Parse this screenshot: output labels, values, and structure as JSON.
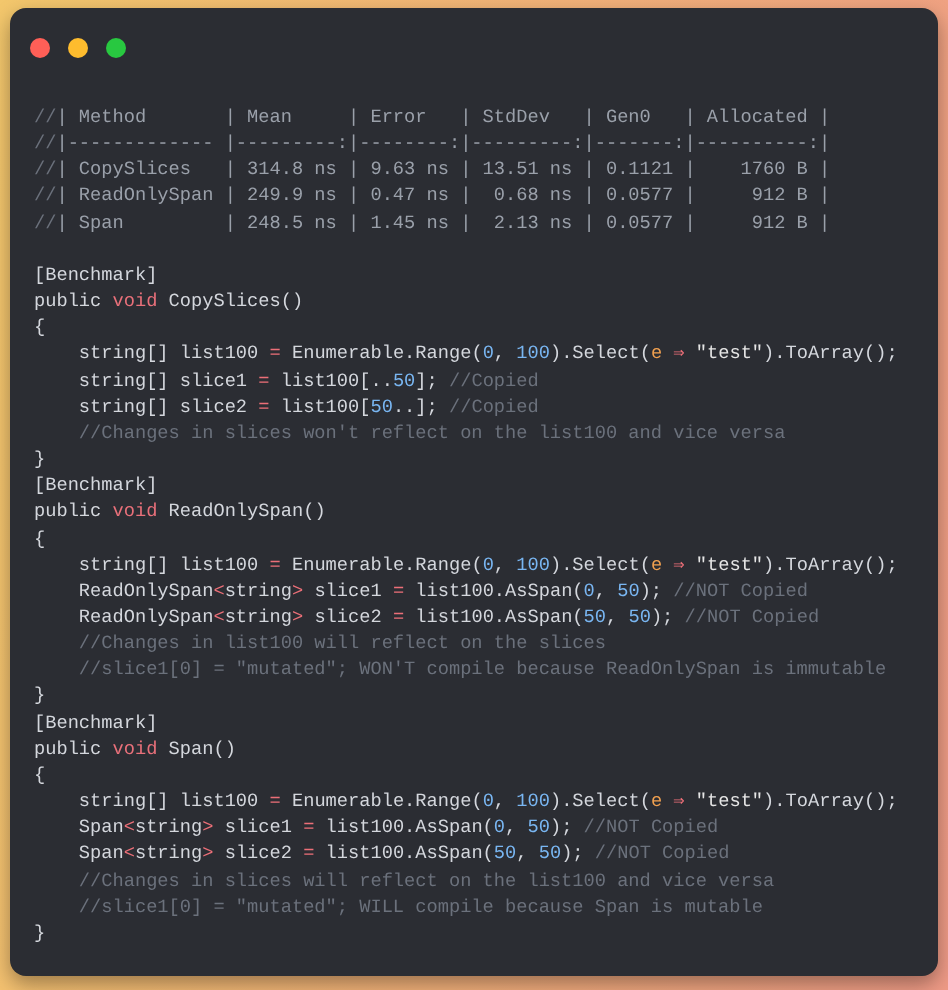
{
  "window": {
    "controls": [
      {
        "kind": "close"
      },
      {
        "kind": "minimize"
      },
      {
        "kind": "maximize"
      }
    ]
  },
  "lines": [
    {
      "kind": "code",
      "tokens": [
        {
          "text": "//",
          "kind": "comment"
        },
        {
          "text": "| Method       | Mean     | Error   | StdDev   | Gen0   | Allocated |",
          "kind": "table"
        }
      ]
    },
    {
      "kind": "code",
      "tokens": [
        {
          "text": "//",
          "kind": "comment"
        },
        {
          "text": "|------------- |---------:|--------:|---------:|-------:|----------:|",
          "kind": "table"
        }
      ]
    },
    {
      "kind": "code",
      "tokens": [
        {
          "text": "//",
          "kind": "comment"
        },
        {
          "text": "| CopySlices   | 314.8 ns | 9.63 ns | 13.51 ns | 0.1121 |    1760 B |",
          "kind": "table"
        }
      ]
    },
    {
      "kind": "code",
      "tokens": [
        {
          "text": "//",
          "kind": "comment"
        },
        {
          "text": "| ReadOnlySpan | 249.9 ns | 0.47 ns |  0.68 ns | 0.0577 |     912 B |",
          "kind": "table"
        }
      ]
    },
    {
      "kind": "code",
      "tokens": [
        {
          "text": "//",
          "kind": "comment"
        },
        {
          "text": "| Span         | 248.5 ns | 1.45 ns |  2.13 ns | 0.0577 |     912 B |",
          "kind": "table"
        }
      ]
    },
    {
      "kind": "blank"
    },
    {
      "kind": "code",
      "tokens": [
        {
          "text": "[Benchmark]",
          "kind": "plain"
        }
      ]
    },
    {
      "kind": "code",
      "tokens": [
        {
          "text": "public ",
          "kind": "plain"
        },
        {
          "text": "void",
          "kind": "keyword"
        },
        {
          "text": " CopySlices()",
          "kind": "plain"
        }
      ]
    },
    {
      "kind": "code",
      "tokens": [
        {
          "text": "{",
          "kind": "plain"
        }
      ]
    },
    {
      "kind": "code",
      "tokens": [
        {
          "text": "    string[] list100 ",
          "kind": "plain"
        },
        {
          "text": "=",
          "kind": "operator"
        },
        {
          "text": " Enumerable.Range(",
          "kind": "plain"
        },
        {
          "text": "0",
          "kind": "number"
        },
        {
          "text": ", ",
          "kind": "plain"
        },
        {
          "text": "100",
          "kind": "number"
        },
        {
          "text": ").Select(",
          "kind": "plain"
        },
        {
          "text": "e",
          "kind": "param"
        },
        {
          "text": " ⇒ ",
          "kind": "operator"
        },
        {
          "text": "\"test\"",
          "kind": "string"
        },
        {
          "text": ").ToArray();",
          "kind": "plain"
        }
      ]
    },
    {
      "kind": "code",
      "tokens": [
        {
          "text": "    string[] slice1 ",
          "kind": "plain"
        },
        {
          "text": "=",
          "kind": "operator"
        },
        {
          "text": " list100[..",
          "kind": "plain"
        },
        {
          "text": "50",
          "kind": "number"
        },
        {
          "text": "]; ",
          "kind": "plain"
        },
        {
          "text": "//Copied",
          "kind": "comment"
        }
      ]
    },
    {
      "kind": "code",
      "tokens": [
        {
          "text": "    string[] slice2 ",
          "kind": "plain"
        },
        {
          "text": "=",
          "kind": "operator"
        },
        {
          "text": " list100[",
          "kind": "plain"
        },
        {
          "text": "50",
          "kind": "number"
        },
        {
          "text": "..]; ",
          "kind": "plain"
        },
        {
          "text": "//Copied",
          "kind": "comment"
        }
      ]
    },
    {
      "kind": "code",
      "tokens": [
        {
          "text": "    //Changes in slices won't reflect on the list100 and vice versa",
          "kind": "comment"
        }
      ]
    },
    {
      "kind": "code",
      "tokens": [
        {
          "text": "}",
          "kind": "plain"
        }
      ]
    },
    {
      "kind": "code",
      "tokens": [
        {
          "text": "[Benchmark]",
          "kind": "plain"
        }
      ]
    },
    {
      "kind": "code",
      "tokens": [
        {
          "text": "public ",
          "kind": "plain"
        },
        {
          "text": "void",
          "kind": "keyword"
        },
        {
          "text": " ReadOnlySpan()",
          "kind": "plain"
        }
      ]
    },
    {
      "kind": "code",
      "tokens": [
        {
          "text": "{",
          "kind": "plain"
        }
      ]
    },
    {
      "kind": "code",
      "tokens": [
        {
          "text": "    string[] list100 ",
          "kind": "plain"
        },
        {
          "text": "=",
          "kind": "operator"
        },
        {
          "text": " Enumerable.Range(",
          "kind": "plain"
        },
        {
          "text": "0",
          "kind": "number"
        },
        {
          "text": ", ",
          "kind": "plain"
        },
        {
          "text": "100",
          "kind": "number"
        },
        {
          "text": ").Select(",
          "kind": "plain"
        },
        {
          "text": "e",
          "kind": "param"
        },
        {
          "text": " ⇒ ",
          "kind": "operator"
        },
        {
          "text": "\"test\"",
          "kind": "string"
        },
        {
          "text": ").ToArray();",
          "kind": "plain"
        }
      ]
    },
    {
      "kind": "code",
      "tokens": [
        {
          "text": "    ReadOnlySpan",
          "kind": "plain"
        },
        {
          "text": "<",
          "kind": "operator"
        },
        {
          "text": "string",
          "kind": "plain"
        },
        {
          "text": ">",
          "kind": "operator"
        },
        {
          "text": " slice1 ",
          "kind": "plain"
        },
        {
          "text": "=",
          "kind": "operator"
        },
        {
          "text": " list100.AsSpan(",
          "kind": "plain"
        },
        {
          "text": "0",
          "kind": "number"
        },
        {
          "text": ", ",
          "kind": "plain"
        },
        {
          "text": "50",
          "kind": "number"
        },
        {
          "text": "); ",
          "kind": "plain"
        },
        {
          "text": "//NOT Copied",
          "kind": "comment"
        }
      ]
    },
    {
      "kind": "code",
      "tokens": [
        {
          "text": "    ReadOnlySpan",
          "kind": "plain"
        },
        {
          "text": "<",
          "kind": "operator"
        },
        {
          "text": "string",
          "kind": "plain"
        },
        {
          "text": ">",
          "kind": "operator"
        },
        {
          "text": " slice2 ",
          "kind": "plain"
        },
        {
          "text": "=",
          "kind": "operator"
        },
        {
          "text": " list100.AsSpan(",
          "kind": "plain"
        },
        {
          "text": "50",
          "kind": "number"
        },
        {
          "text": ", ",
          "kind": "plain"
        },
        {
          "text": "50",
          "kind": "number"
        },
        {
          "text": "); ",
          "kind": "plain"
        },
        {
          "text": "//NOT Copied",
          "kind": "comment"
        }
      ]
    },
    {
      "kind": "code",
      "tokens": [
        {
          "text": "    //Changes in list100 will reflect on the slices",
          "kind": "comment"
        }
      ]
    },
    {
      "kind": "code",
      "tokens": [
        {
          "text": "    //slice1[0] = \"mutated\"; WON'T compile because ReadOnlySpan is immutable",
          "kind": "comment"
        }
      ]
    },
    {
      "kind": "code",
      "tokens": [
        {
          "text": "}",
          "kind": "plain"
        }
      ]
    },
    {
      "kind": "code",
      "tokens": [
        {
          "text": "[Benchmark]",
          "kind": "plain"
        }
      ]
    },
    {
      "kind": "code",
      "tokens": [
        {
          "text": "public ",
          "kind": "plain"
        },
        {
          "text": "void",
          "kind": "keyword"
        },
        {
          "text": " Span()",
          "kind": "plain"
        }
      ]
    },
    {
      "kind": "code",
      "tokens": [
        {
          "text": "{",
          "kind": "plain"
        }
      ]
    },
    {
      "kind": "code",
      "tokens": [
        {
          "text": "    string[] list100 ",
          "kind": "plain"
        },
        {
          "text": "=",
          "kind": "operator"
        },
        {
          "text": " Enumerable.Range(",
          "kind": "plain"
        },
        {
          "text": "0",
          "kind": "number"
        },
        {
          "text": ", ",
          "kind": "plain"
        },
        {
          "text": "100",
          "kind": "number"
        },
        {
          "text": ").Select(",
          "kind": "plain"
        },
        {
          "text": "e",
          "kind": "param"
        },
        {
          "text": " ⇒ ",
          "kind": "operator"
        },
        {
          "text": "\"test\"",
          "kind": "string"
        },
        {
          "text": ").ToArray();",
          "kind": "plain"
        }
      ]
    },
    {
      "kind": "code",
      "tokens": [
        {
          "text": "    Span",
          "kind": "plain"
        },
        {
          "text": "<",
          "kind": "operator"
        },
        {
          "text": "string",
          "kind": "plain"
        },
        {
          "text": ">",
          "kind": "operator"
        },
        {
          "text": " slice1 ",
          "kind": "plain"
        },
        {
          "text": "=",
          "kind": "operator"
        },
        {
          "text": " list100.AsSpan(",
          "kind": "plain"
        },
        {
          "text": "0",
          "kind": "number"
        },
        {
          "text": ", ",
          "kind": "plain"
        },
        {
          "text": "50",
          "kind": "number"
        },
        {
          "text": "); ",
          "kind": "plain"
        },
        {
          "text": "//NOT Copied",
          "kind": "comment"
        }
      ]
    },
    {
      "kind": "code",
      "tokens": [
        {
          "text": "    Span",
          "kind": "plain"
        },
        {
          "text": "<",
          "kind": "operator"
        },
        {
          "text": "string",
          "kind": "plain"
        },
        {
          "text": ">",
          "kind": "operator"
        },
        {
          "text": " slice2 ",
          "kind": "plain"
        },
        {
          "text": "=",
          "kind": "operator"
        },
        {
          "text": " list100.AsSpan(",
          "kind": "plain"
        },
        {
          "text": "50",
          "kind": "number"
        },
        {
          "text": ", ",
          "kind": "plain"
        },
        {
          "text": "50",
          "kind": "number"
        },
        {
          "text": "); ",
          "kind": "plain"
        },
        {
          "text": "//NOT Copied",
          "kind": "comment"
        }
      ]
    },
    {
      "kind": "code",
      "tokens": [
        {
          "text": "    //Changes in slices will reflect on the list100 and vice versa",
          "kind": "comment"
        }
      ]
    },
    {
      "kind": "code",
      "tokens": [
        {
          "text": "    //slice1[0] = \"mutated\"; WILL compile because Span is mutable",
          "kind": "comment"
        }
      ]
    },
    {
      "kind": "code",
      "tokens": [
        {
          "text": "}",
          "kind": "plain"
        }
      ]
    }
  ]
}
